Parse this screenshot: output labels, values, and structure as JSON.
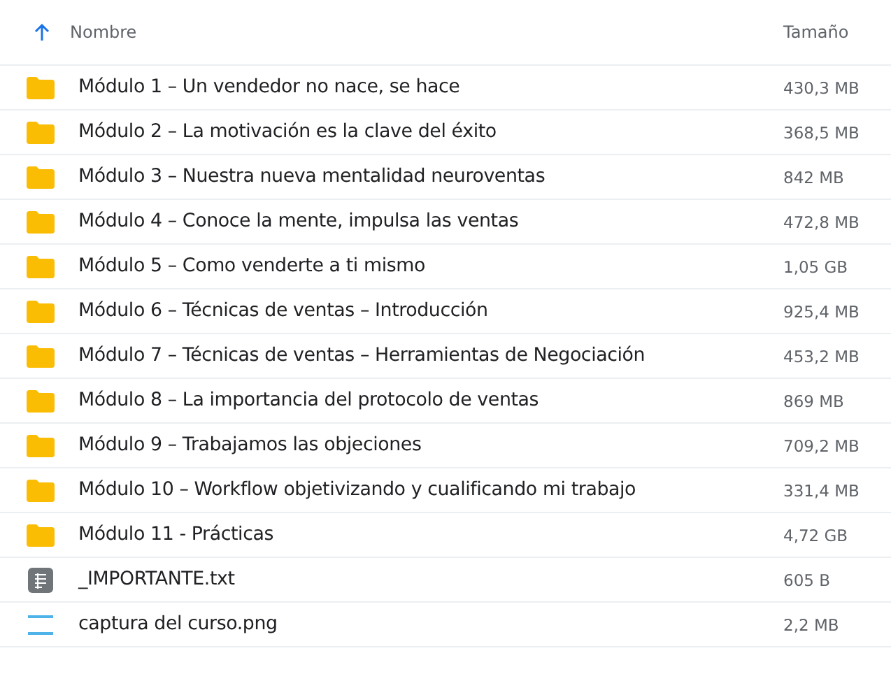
{
  "columns": {
    "name": "Nombre",
    "size": "Tamaño",
    "sort_ascending": true
  },
  "rows": [
    {
      "kind": "folder",
      "name": "Módulo 1 – Un vendedor no nace, se hace",
      "size": "430,3 MB"
    },
    {
      "kind": "folder",
      "name": "Módulo 2 – La motivación es la clave del éxito",
      "size": "368,5 MB"
    },
    {
      "kind": "folder",
      "name": "Módulo 3 – Nuestra nueva mentalidad neuroventas",
      "size": "842 MB"
    },
    {
      "kind": "folder",
      "name": "Módulo 4 – Conoce la mente, impulsa las ventas",
      "size": "472,8 MB"
    },
    {
      "kind": "folder",
      "name": "Módulo 5 – Como venderte a ti mismo",
      "size": "1,05 GB"
    },
    {
      "kind": "folder",
      "name": "Módulo 6 – Técnicas de ventas – Introducción",
      "size": "925,4 MB"
    },
    {
      "kind": "folder",
      "name": "Módulo 7 – Técnicas de ventas – Herramientas de Negociación",
      "size": "453,2 MB"
    },
    {
      "kind": "folder",
      "name": "Módulo 8 – La importancia del protocolo de ventas",
      "size": "869 MB"
    },
    {
      "kind": "folder",
      "name": "Módulo 9 – Trabajamos las objeciones",
      "size": "709,2 MB"
    },
    {
      "kind": "folder",
      "name": "Módulo 10 – Workflow objetivizando y cualificando mi trabajo",
      "size": "331,4 MB"
    },
    {
      "kind": "folder",
      "name": "Módulo 11 - Prácticas",
      "size": "4,72 GB"
    },
    {
      "kind": "text",
      "name": "_IMPORTANTE.txt",
      "size": "605 B"
    },
    {
      "kind": "image",
      "name": "captura del curso.png",
      "size": "2,2 MB"
    }
  ]
}
